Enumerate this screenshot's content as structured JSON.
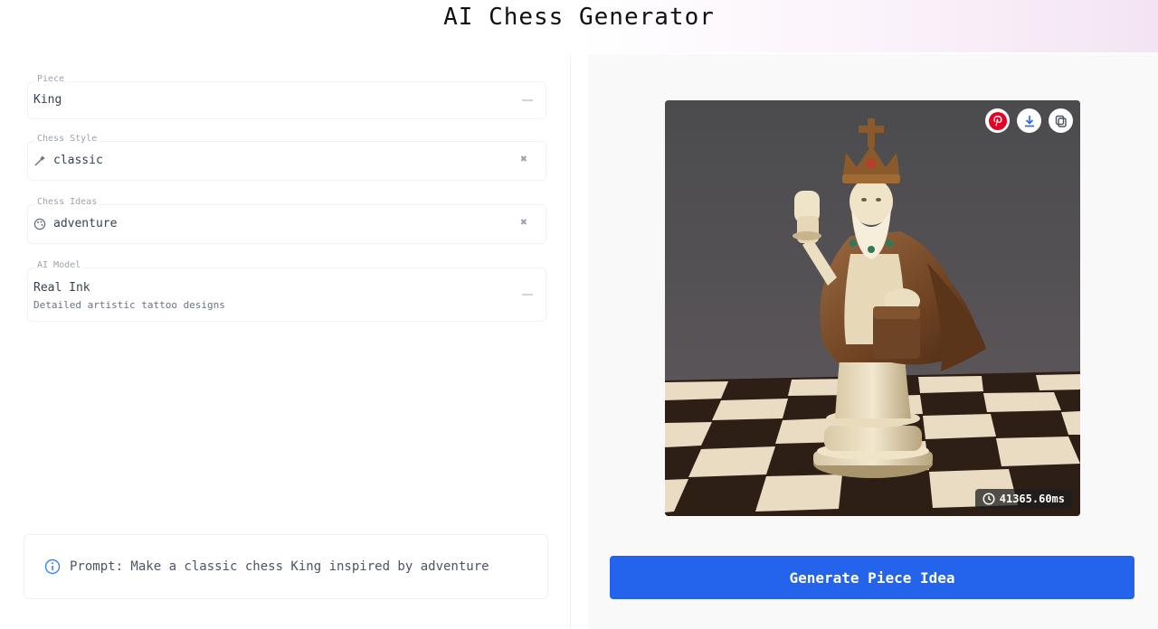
{
  "header": {
    "title": "AI Chess Generator"
  },
  "form": {
    "piece": {
      "label": "Piece",
      "value": "King"
    },
    "style": {
      "label": "Chess Style",
      "value": "classic"
    },
    "ideas": {
      "label": "Chess Ideas",
      "value": "adventure"
    },
    "model": {
      "label": "AI Model",
      "value": "Real Ink",
      "description": "Detailed artistic tattoo designs"
    }
  },
  "prompt": {
    "text": "Prompt: Make a classic chess King inspired by adventure"
  },
  "result": {
    "time": "41365.60ms",
    "actions": [
      "pinterest-icon",
      "download-icon",
      "copy-icon"
    ]
  },
  "generate": {
    "label": "Generate Piece Idea"
  },
  "colors": {
    "accent": "#2463eb",
    "pinterest": "#e60023"
  }
}
